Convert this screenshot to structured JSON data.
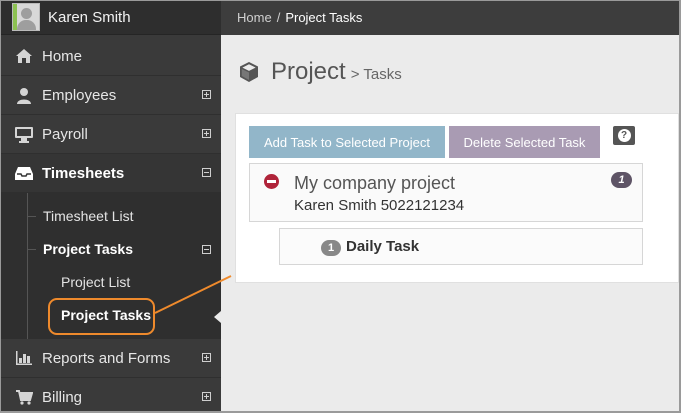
{
  "user": {
    "name": "Karen Smith"
  },
  "sidebar": {
    "items": [
      {
        "label": "Home",
        "icon": "home-icon",
        "expander": "none"
      },
      {
        "label": "Employees",
        "icon": "user-icon",
        "expander": "plus"
      },
      {
        "label": "Payroll",
        "icon": "monitor-icon",
        "expander": "plus"
      },
      {
        "label": "Timesheets",
        "icon": "inbox-icon",
        "expander": "minus"
      },
      {
        "label": "Reports and Forms",
        "icon": "bar-chart-icon",
        "expander": "plus"
      },
      {
        "label": "Billing",
        "icon": "cart-icon",
        "expander": "plus"
      }
    ],
    "submenu": {
      "timesheet_list": "Timesheet List",
      "project_tasks": "Project Tasks",
      "project_list": "Project List",
      "project_tasks_child": "Project Tasks"
    }
  },
  "breadcrumb": {
    "home": "Home",
    "separator": "/",
    "current": "Project Tasks"
  },
  "page": {
    "title": "Project",
    "subtitle": "> Tasks"
  },
  "toolbar": {
    "add_label": "Add Task to Selected Project",
    "delete_label": "Delete Selected Task",
    "help_label": "?"
  },
  "project": {
    "name": "My company project",
    "user": "Karen Smith 5022121234",
    "count": "1"
  },
  "task": {
    "number": "1",
    "name": "Daily Task"
  },
  "colors": {
    "accent_orange": "#ef8a2c",
    "add_button": "#92b6c9",
    "delete_button": "#a99bb3",
    "minus_red": "#b0243a",
    "badge_purple": "#5e5466"
  }
}
